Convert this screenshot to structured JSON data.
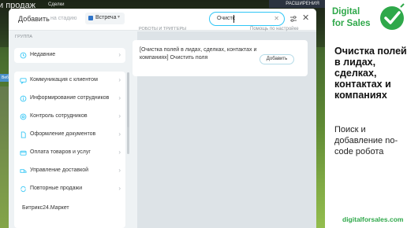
{
  "background": {
    "page_title": "и продаж",
    "top_label": "Сделки",
    "right_label": "РАСШИРЕНИЯ",
    "web_label": "Веб"
  },
  "modal": {
    "add_label": "Добавить",
    "stage_label": "на стадию",
    "stage_value": "Встреча",
    "stage_color": "#2f74c9",
    "search_value": "Очистк",
    "left_header": "ГРУППА",
    "groups": [
      {
        "label": "Недавние",
        "icon": "clock-icon"
      },
      {
        "label": "Коммуникация с клиентом",
        "icon": "chat-icon"
      },
      {
        "label": "Информирование сотрудников",
        "icon": "info-icon"
      },
      {
        "label": "Контроль сотрудников",
        "icon": "target-icon"
      },
      {
        "label": "Оформление документов",
        "icon": "document-icon"
      },
      {
        "label": "Оплата товаров и услуг",
        "icon": "payment-icon"
      },
      {
        "label": "Управление доставкой",
        "icon": "delivery-icon"
      },
      {
        "label": "Повторные продажи",
        "icon": "repeat-icon"
      }
    ],
    "bitrix_item": "Битрикс24.Маркет",
    "right_header": "РОБОТЫ И ТРИГГЕРЫ",
    "help_link": "Помощь по настройке",
    "robot_card": {
      "text": "[Очистка полей в лидах, сделках, контактах и компаниях] Очистить поля",
      "button": "Добавить"
    }
  },
  "promo": {
    "brand_line1": "Digital",
    "brand_line2": "for Sales",
    "title": "Очистка полей в лидах, сделках, контактах и компаниях",
    "subtitle": "Поиск и добавление no-code робота",
    "site": "digitalforsales.com",
    "brand_color": "#2fa84a"
  }
}
